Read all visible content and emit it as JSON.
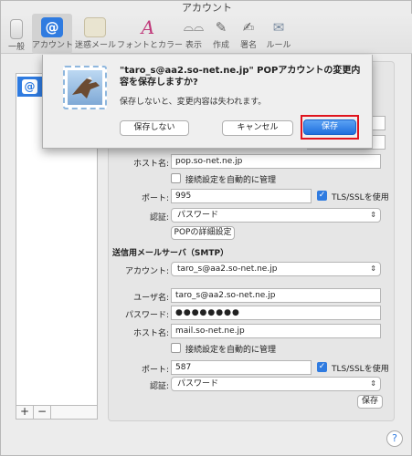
{
  "window": {
    "title": "アカウント"
  },
  "toolbar": {
    "items": [
      {
        "label": "一般",
        "icon": "switch-icon"
      },
      {
        "label": "アカウント",
        "icon": "at-icon"
      },
      {
        "label": "迷惑メール",
        "icon": "junk-mail-icon"
      },
      {
        "label": "フォントとカラー",
        "icon": "font-icon"
      },
      {
        "label": "表示",
        "icon": "glasses-icon"
      },
      {
        "label": "作成",
        "icon": "pencil-icon"
      },
      {
        "label": "署名",
        "icon": "signature-icon"
      },
      {
        "label": "ルール",
        "icon": "rules-icon"
      }
    ],
    "active_index": 1
  },
  "sidebar": {
    "account_icon": "@",
    "add_label": "+",
    "remove_label": "−"
  },
  "incoming": {
    "host_label": "ホスト名:",
    "host_value": "pop.so-net.ne.jp",
    "auto_label": "接続設定を自動的に管理",
    "port_label": "ポート:",
    "port_value": "995",
    "tls_label": "TLS/SSLを使用",
    "auth_label": "認証:",
    "auth_value": "パスワード",
    "pop_detail_button": "POPの詳細設定"
  },
  "smtp": {
    "section_title": "送信用メールサーバ（SMTP）",
    "account_label": "アカウント:",
    "account_value": "taro_s@aa2.so-net.ne.jp",
    "user_label": "ユーザ名:",
    "user_value": "taro_s@aa2.so-net.ne.jp",
    "password_label": "パスワード:",
    "password_value": "●●●●●●●●",
    "host_label": "ホスト名:",
    "host_value": "mail.so-net.ne.jp",
    "auto_label": "接続設定を自動的に管理",
    "port_label": "ポート:",
    "port_value": "587",
    "tls_label": "TLS/SSLを使用",
    "auth_label": "認証:",
    "auth_value": "パスワード",
    "save_button": "保存"
  },
  "help": {
    "label": "?"
  },
  "sheet": {
    "title": "\"taro_s@aa2.so-net.ne.jp\" POPアカウントの変更内容を保存しますか?",
    "message": "保存しないと、変更内容は失われます。",
    "dont_save_button": "保存しない",
    "cancel_button": "キャンセル",
    "save_button": "保存"
  },
  "colors": {
    "accent": "#2f7be0",
    "highlight_border": "#e0141e"
  }
}
